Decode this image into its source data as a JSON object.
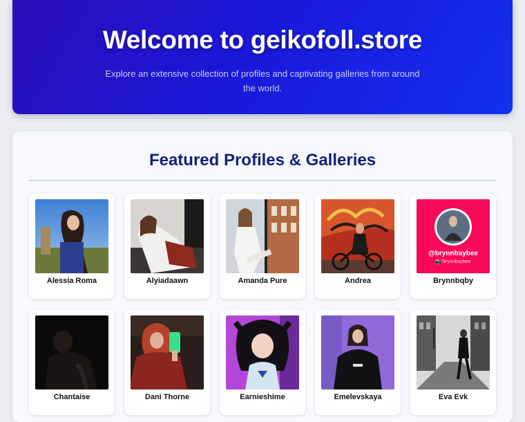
{
  "hero": {
    "title": "Welcome to geikofoll.store",
    "subtitle": "Explore an extensive collection of profiles and captivating galleries from around the world."
  },
  "section": {
    "title": "Featured Profiles & Galleries"
  },
  "profiles": [
    {
      "name": "Alessia Roma"
    },
    {
      "name": "Alyiadaawn"
    },
    {
      "name": "Amanda Pure"
    },
    {
      "name": "Andrea"
    },
    {
      "name": "Brynnbqby",
      "overlay_handle": "@brynnbaybee",
      "overlay_sub": "📷/brynnbaybee"
    },
    {
      "name": "Chantaise"
    },
    {
      "name": "Dani Thorne"
    },
    {
      "name": "Earnieshime"
    },
    {
      "name": "Emelevskaya"
    },
    {
      "name": "Eva Evk"
    }
  ]
}
